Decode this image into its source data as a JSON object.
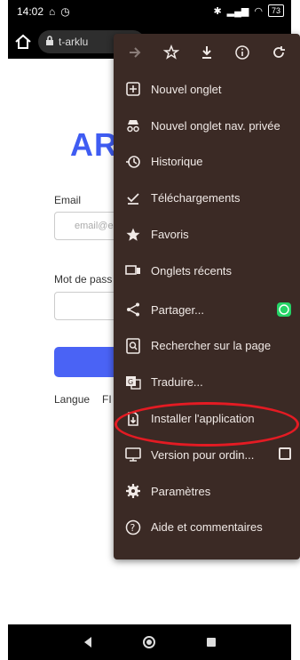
{
  "status": {
    "time": "14:02",
    "battery": "73"
  },
  "browser": {
    "url": "t-arklu"
  },
  "page": {
    "logo_text": "AR",
    "email_label": "Email",
    "email_placeholder": "email@e",
    "password_label": "Mot de pass",
    "language_label": "Langue",
    "language_value": "FI"
  },
  "menu": {
    "toolbar": [
      "forward-icon",
      "star-icon",
      "download-icon",
      "info-icon",
      "refresh-icon"
    ],
    "items": [
      {
        "label": "Nouvel onglet",
        "icon": "new-tab-icon"
      },
      {
        "label": "Nouvel onglet nav. privée",
        "icon": "incognito-icon"
      },
      {
        "label": "Historique",
        "icon": "history-icon"
      },
      {
        "label": "Téléchargements",
        "icon": "downloads-icon"
      },
      {
        "label": "Favoris",
        "icon": "star-icon"
      },
      {
        "label": "Onglets récents",
        "icon": "recent-tabs-icon"
      },
      {
        "label": "Partager...",
        "icon": "share-icon",
        "trailing": "whatsapp-icon"
      },
      {
        "label": "Rechercher sur la page",
        "icon": "find-in-page-icon"
      },
      {
        "label": "Traduire...",
        "icon": "translate-icon"
      },
      {
        "label": "Installer l'application",
        "icon": "install-app-icon"
      },
      {
        "label": "Version pour ordin...",
        "icon": "desktop-icon",
        "trailing": "checkbox"
      },
      {
        "label": "Paramètres",
        "icon": "settings-icon"
      },
      {
        "label": "Aide et commentaires",
        "icon": "help-icon"
      }
    ]
  },
  "colors": {
    "menu_bg": "#3b2a25",
    "accent": "#4a63f5",
    "highlight": "#e31b23"
  }
}
